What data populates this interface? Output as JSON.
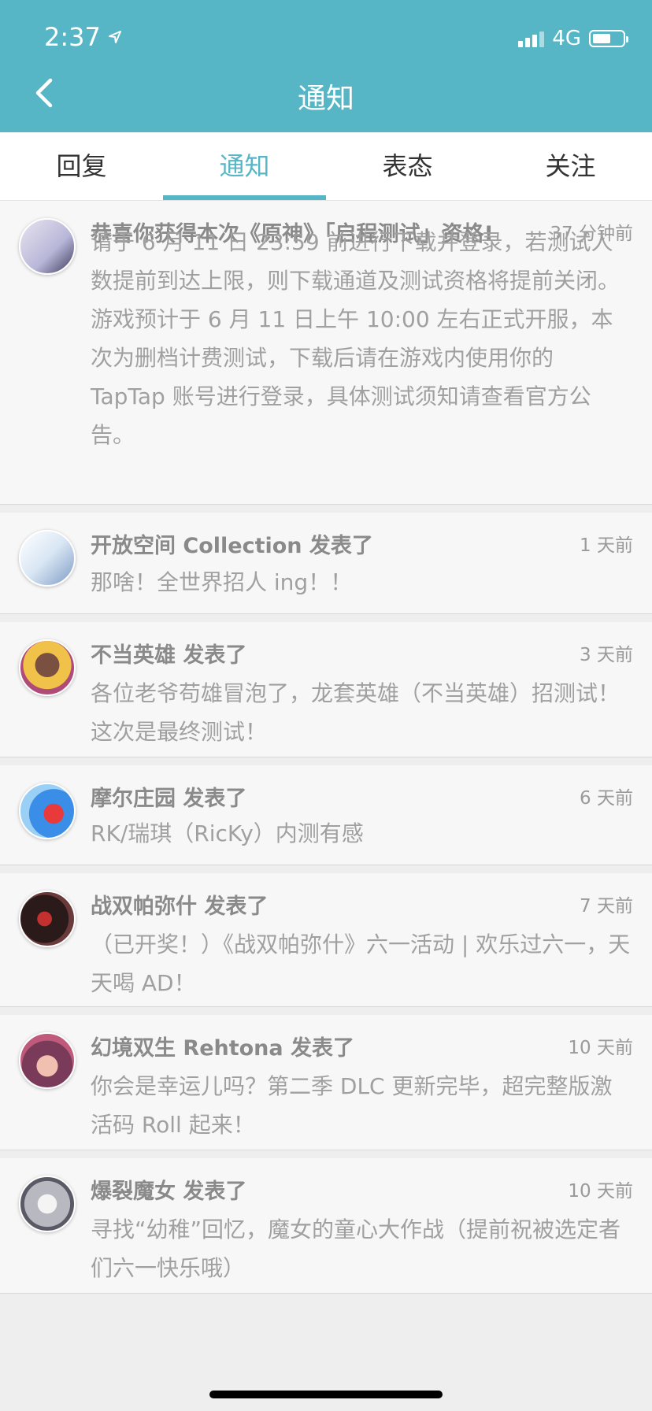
{
  "status_bar": {
    "time": "2:37",
    "network": "4G"
  },
  "header": {
    "title": "通知"
  },
  "tabs": [
    {
      "label": "回复",
      "active": false
    },
    {
      "label": "通知",
      "active": true
    },
    {
      "label": "表态",
      "active": false
    },
    {
      "label": "关注",
      "active": false
    }
  ],
  "notifications": [
    {
      "title": "恭喜你获得本次《原神》「启程测试」资格!",
      "time": "37 分钟前",
      "body": "请于 6 月 11 日 23:59 前进行下载并登录，若测试人数提前到达上限，则下载通道及测试资格将提前关闭。游戏预计于 6 月 11 日上午 10:00 左右正式开服，本次为删档计费测试，下载后请在游戏内使用你的 TapTap 账号进行登录，具体测试须知请查看官方公告。"
    },
    {
      "title": "开放空间 Collection 发表了",
      "time": "1 天前",
      "body": "那啥！全世界招人 ing！！"
    },
    {
      "title": "不当英雄 发表了",
      "time": "3 天前",
      "body": "各位老爷苟雄冒泡了，龙套英雄（不当英雄）招测试！这次是最终测试！"
    },
    {
      "title": "摩尔庄园 发表了",
      "time": "6 天前",
      "body": "RK/瑞琪（RicKy）内测有感"
    },
    {
      "title": "战双帕弥什 发表了",
      "time": "7 天前",
      "body": "（已开奖！）《战双帕弥什》六一活动 | 欢乐过六一，天天喝 AD！"
    },
    {
      "title": "幻境双生 Rehtona 发表了",
      "time": "10 天前",
      "body": "你会是幸运儿吗？第二季 DLC 更新完毕，超完整版激活码 Roll 起来！"
    },
    {
      "title": "爆裂魔女 发表了",
      "time": "10 天前",
      "body": "寻找“幼稚”回忆，魔女的童心大作战（提前祝被选定者们六一快乐哦）"
    }
  ]
}
